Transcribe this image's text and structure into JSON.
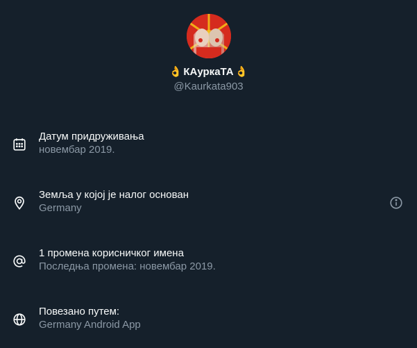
{
  "profile": {
    "display_name": "КАуркаТА",
    "emoji_left": "👌",
    "emoji_right": "👌",
    "handle": "@Kaurkata903"
  },
  "rows": [
    {
      "icon": "calendar-icon",
      "title": "Датум придруживања",
      "sub": "новембар 2019."
    },
    {
      "icon": "location-pin-icon",
      "title": "Земља у којој је налог основан",
      "sub": "Germany",
      "info_icon": "info-icon"
    },
    {
      "icon": "at-sign-icon",
      "title": "1 промена корисничког имена",
      "sub": "Последња промена: новембар 2019."
    },
    {
      "icon": "globe-icon",
      "title": "Повезано путем:",
      "sub": "Germany Android App"
    }
  ],
  "colors": {
    "background": "#15202b",
    "primary_text": "#f7f9f9",
    "secondary_text": "#8b98a5"
  }
}
